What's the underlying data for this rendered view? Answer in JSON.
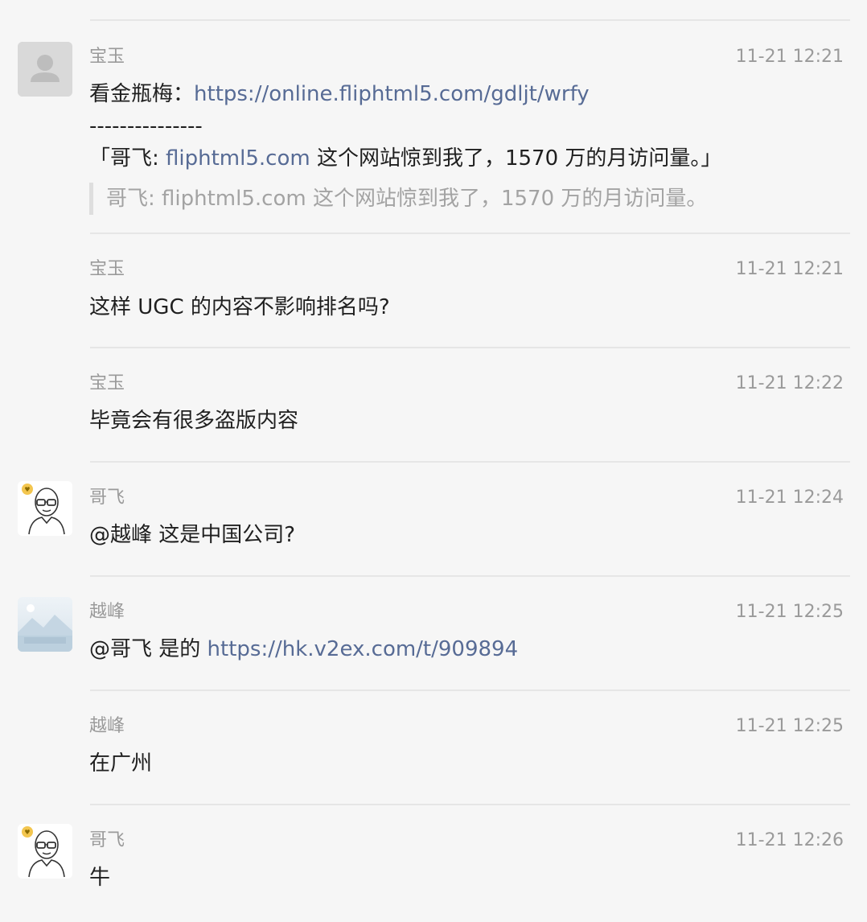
{
  "messages": [
    {
      "sender": "宝玉",
      "time": "11-21 12:21",
      "line1_prefix": "看金瓶梅：",
      "line1_link": "https://online.fliphtml5.com/gdljt/wrfy",
      "line2": "---------------",
      "line3_open": "「哥飞: ",
      "line3_link": "fliphtml5.com",
      "line3_rest": " 这个网站惊到我了，1570 万的月访问量。」",
      "quote": "哥飞: fliphtml5.com 这个网站惊到我了，1570 万的月访问量。",
      "avatar": "default-user-icon"
    },
    {
      "sender": "宝玉",
      "time": "11-21 12:21",
      "text": "这样 UGC 的内容不影响排名吗?"
    },
    {
      "sender": "宝玉",
      "time": "11-21 12:22",
      "text": "毕竟会有很多盗版内容"
    },
    {
      "sender": "哥飞",
      "time": "11-21 12:24",
      "text": "@越峰 这是中国公司?",
      "avatar": "bald-glasses-man-icon"
    },
    {
      "sender": "越峰",
      "time": "11-21 12:25",
      "prefix": "@哥飞 是的 ",
      "link": "https://hk.v2ex.com/t/909894",
      "avatar": "landscape-image-icon"
    },
    {
      "sender": "越峰",
      "time": "11-21 12:25",
      "text": "在广州"
    },
    {
      "sender": "哥飞",
      "time": "11-21 12:26",
      "text": "牛",
      "avatar": "bald-glasses-man-icon"
    }
  ]
}
